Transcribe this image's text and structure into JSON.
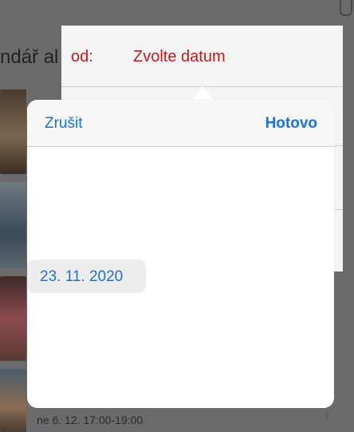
{
  "background": {
    "title_fragment": "ndář al",
    "event_date": "ne 6. 12. 17:00-19:00",
    "chevron": "›"
  },
  "form": {
    "from_label": "od:",
    "from_value": "Zvolte datum"
  },
  "picker": {
    "cancel_label": "Zrušit",
    "done_label": "Hotovo",
    "selected_date": "23. 11. 2020"
  },
  "colors": {
    "accent": "#1a73d9",
    "error_red": "#c41a1a"
  }
}
